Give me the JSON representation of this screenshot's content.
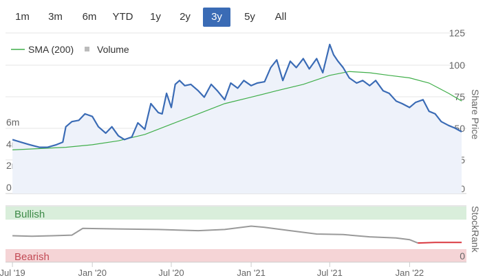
{
  "range_selector": {
    "buttons": [
      "1m",
      "3m",
      "6m",
      "YTD",
      "1y",
      "2y",
      "3y",
      "5y",
      "All"
    ],
    "active": "3y"
  },
  "legend": {
    "sma_label": "SMA (200)",
    "volume_label": "Volume"
  },
  "colors": {
    "price_line": "#3a6bb5",
    "price_fill": "#eef2fa",
    "sma_line": "#3fae49",
    "volume_bar": "#bbbbbb",
    "bullish_band": "#d9eedb",
    "bullish_text": "#3d8a47",
    "bearish_band": "#f5d4d6",
    "bearish_text": "#c24a55",
    "rank_line_bull": "#999999",
    "rank_line_bear": "#d9363e",
    "active_button": "#3a6bb5"
  },
  "chart_data": [
    {
      "type": "line",
      "title": "",
      "y_axis_right_title": "Share Price",
      "y_axis_right_ticks": [
        "125",
        "100",
        "75",
        "50",
        "25",
        "0.00"
      ],
      "y_axis_right_tick_values": [
        125,
        100,
        75,
        50,
        25,
        0
      ],
      "y_axis_left_volume_ticks": [
        "6m",
        "4m",
        "2m",
        "0"
      ],
      "y_axis_left_volume_values": [
        6000000,
        4000000,
        2000000,
        0
      ],
      "x_tick_labels": [
        "Jul '19",
        "Jan '20",
        "Jul '20",
        "Jan '21",
        "Jul '21",
        "Jan '22"
      ],
      "series": [
        {
          "name": "Share Price",
          "x": [
            "2019-07-01",
            "2019-07-20",
            "2019-08-10",
            "2019-09-01",
            "2019-09-20",
            "2019-10-10",
            "2019-10-25",
            "2019-11-01",
            "2019-11-15",
            "2019-12-01",
            "2019-12-15",
            "2020-01-01",
            "2020-01-15",
            "2020-02-01",
            "2020-02-15",
            "2020-03-01",
            "2020-03-15",
            "2020-04-01",
            "2020-04-15",
            "2020-05-01",
            "2020-05-15",
            "2020-06-01",
            "2020-06-10",
            "2020-06-20",
            "2020-07-01",
            "2020-07-10",
            "2020-07-20",
            "2020-08-01",
            "2020-08-15",
            "2020-09-01",
            "2020-09-15",
            "2020-10-01",
            "2020-10-15",
            "2020-11-01",
            "2020-11-15",
            "2020-12-01",
            "2020-12-15",
            "2021-01-01",
            "2021-01-15",
            "2021-02-01",
            "2021-02-15",
            "2021-03-01",
            "2021-03-15",
            "2021-04-01",
            "2021-04-15",
            "2021-05-01",
            "2021-05-15",
            "2021-06-01",
            "2021-06-15",
            "2021-07-01",
            "2021-07-10",
            "2021-07-20",
            "2021-08-01",
            "2021-08-15",
            "2021-09-01",
            "2021-09-15",
            "2021-10-01",
            "2021-10-15",
            "2021-11-01",
            "2021-11-15",
            "2021-12-01",
            "2021-12-15",
            "2022-01-01",
            "2022-01-15",
            "2022-02-01",
            "2022-02-15",
            "2022-03-01",
            "2022-03-15",
            "2022-04-01",
            "2022-04-15",
            "2022-05-01"
          ],
          "values": [
            42,
            40,
            38,
            36,
            36,
            38,
            40,
            52,
            56,
            57,
            62,
            60,
            52,
            47,
            52,
            45,
            42,
            44,
            55,
            50,
            70,
            63,
            62,
            78,
            67,
            85,
            88,
            84,
            85,
            80,
            75,
            85,
            80,
            73,
            86,
            82,
            88,
            84,
            86,
            87,
            98,
            104,
            88,
            103,
            98,
            105,
            97,
            105,
            94,
            116,
            108,
            103,
            98,
            90,
            86,
            88,
            84,
            88,
            80,
            78,
            72,
            70,
            67,
            71,
            73,
            64,
            62,
            56,
            53,
            51,
            48
          ]
        },
        {
          "name": "SMA (200)",
          "x": [
            "2019-07-01",
            "2019-09-01",
            "2019-11-01",
            "2020-01-01",
            "2020-03-01",
            "2020-05-01",
            "2020-07-01",
            "2020-09-01",
            "2020-11-01",
            "2021-01-01",
            "2021-03-01",
            "2021-05-01",
            "2021-07-01",
            "2021-08-15",
            "2021-10-01",
            "2021-11-15",
            "2022-01-01",
            "2022-02-15",
            "2022-04-01",
            "2022-05-01"
          ],
          "values": [
            34,
            35,
            36,
            38,
            41,
            46,
            54,
            62,
            70,
            75,
            80,
            85,
            92,
            95,
            94,
            92,
            90,
            86,
            78,
            72
          ]
        }
      ],
      "volume": {
        "x": [
          "2019-07-15",
          "2019-09-01",
          "2019-11-15",
          "2019-12-10",
          "2020-02-01",
          "2020-03-20",
          "2020-05-10",
          "2020-07-01",
          "2020-08-20",
          "2020-10-20",
          "2020-12-20",
          "2021-01-20",
          "2021-03-10",
          "2021-05-01",
          "2021-06-20",
          "2021-08-15",
          "2021-10-10",
          "2021-12-10",
          "2022-02-01",
          "2022-03-20",
          "2022-04-25"
        ],
        "values": [
          200000,
          150000,
          300000,
          3600000,
          250000,
          200000,
          300000,
          250000,
          300000,
          250000,
          350000,
          200000,
          4700000,
          300000,
          250000,
          250000,
          400000,
          250000,
          300000,
          200000,
          900000
        ]
      }
    },
    {
      "type": "line",
      "title": "",
      "y_axis_right_title": "StockRank",
      "y_axis_right_ticks": [
        "0"
      ],
      "y_axis_right_tick_values": [
        0
      ],
      "bands": [
        "Bullish",
        "Bearish"
      ],
      "series": [
        {
          "name": "StockRank",
          "x": [
            "2019-07-01",
            "2019-08-15",
            "2019-10-01",
            "2019-11-15",
            "2019-12-10",
            "2020-03-01",
            "2020-06-01",
            "2020-09-01",
            "2020-11-01",
            "2021-01-01",
            "2021-02-01",
            "2021-04-01",
            "2021-06-01",
            "2021-08-01",
            "2021-10-01",
            "2021-12-01",
            "2022-01-01",
            "2022-01-20",
            "2022-03-01",
            "2022-05-01"
          ],
          "values": [
            47,
            46,
            47,
            48,
            60,
            59,
            58,
            56,
            58,
            64,
            62,
            56,
            50,
            49,
            45,
            43,
            40,
            34,
            35,
            35
          ]
        }
      ]
    }
  ]
}
